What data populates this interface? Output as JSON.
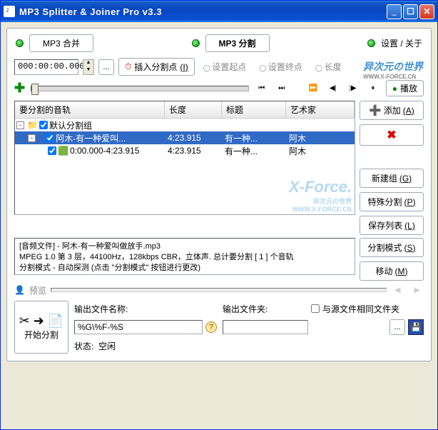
{
  "window": {
    "title": "MP3 Splitter & Joiner Pro v3.3"
  },
  "tabs": {
    "merge": "MP3 合并",
    "split": "MP3 分割",
    "settings": "设置 / 关于"
  },
  "time": {
    "value": "000:00:00.000"
  },
  "insert": {
    "label": "插入分割点",
    "key": "(I)"
  },
  "disabled": {
    "set_start": "设置起点",
    "set_end": "设置终点",
    "length": "长度"
  },
  "play": {
    "label": "播放"
  },
  "headers": {
    "track": "要分割的音轨",
    "length": "长度",
    "title": "标题",
    "artist": "艺术家"
  },
  "rows": {
    "group": "默认分割组",
    "file": {
      "name": "阿木-有一种爱叫...",
      "len": "4:23.915",
      "title": "有一种...",
      "artist": "阿木"
    },
    "seg": {
      "name": "0:00.000-4:23.915",
      "len": "4:23.915",
      "title": "有一种...",
      "artist": "阿木"
    }
  },
  "side": {
    "add": "添加",
    "add_k": "(A)",
    "newgrp": "新建组",
    "newgrp_k": "(G)",
    "special": "特殊分割",
    "special_k": "(P)",
    "savelist": "保存列表",
    "savelist_k": "(L)",
    "mode": "分割模式",
    "mode_k": "(S)",
    "move": "移动",
    "move_k": "(M)"
  },
  "info": {
    "l1": "[音频文件] - 阿木-有一种爱叫做放手.mp3",
    "l2": "MPEG 1.0 第 3 层，44100Hz，128kbps CBR，立体声. 总计要分割 [ 1 ] 个音轨",
    "l3": "分割模式 - 自动探测 (点击 \"分割模式\" 按钮进行更改)"
  },
  "preview": {
    "label": "预览"
  },
  "output": {
    "name_label": "输出文件名称:",
    "name_value": "%G\\%F-%S",
    "folder_label": "输出文件夹:",
    "folder_value": "",
    "same_folder": "与源文件相同文件夹",
    "status_label": "状态:",
    "status_value": "空闲"
  },
  "start": {
    "label": "开始分割"
  },
  "watermark": {
    "brand": "异次元の世界",
    "url": "WWW.X-FORCE.CN",
    "big": "X-Force."
  }
}
